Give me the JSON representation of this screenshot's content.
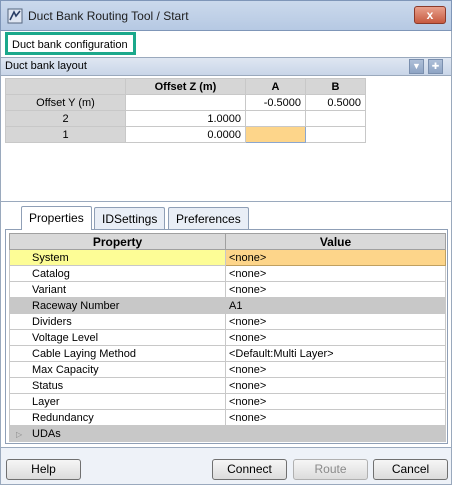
{
  "window": {
    "title": "Duct Bank Routing Tool / Start",
    "close_label": "x"
  },
  "config": {
    "label": "Duct bank configuration"
  },
  "layout": {
    "header_label": "Duct bank layout",
    "grid": {
      "corner": "",
      "offset_z_header": "Offset Z (m)",
      "col_a": "A",
      "col_b": "B",
      "rows": [
        {
          "label": "Offset Y (m)",
          "z": "",
          "a": "-0.5000",
          "b": "0.5000"
        },
        {
          "label": "2",
          "z": "1.0000",
          "a": "",
          "b": ""
        },
        {
          "label": "1",
          "z": "0.0000",
          "a": "",
          "b": ""
        }
      ]
    }
  },
  "tabs": [
    {
      "label": "Properties"
    },
    {
      "label": "IDSettings"
    },
    {
      "label": "Preferences"
    }
  ],
  "properties": {
    "header_property": "Property",
    "header_value": "Value",
    "rows": [
      {
        "name": "System",
        "value": "<none>"
      },
      {
        "name": "Catalog",
        "value": "<none>"
      },
      {
        "name": "Variant",
        "value": "<none>"
      },
      {
        "name": "Raceway Number",
        "value": "A1"
      },
      {
        "name": "Dividers",
        "value": "<none>"
      },
      {
        "name": "Voltage Level",
        "value": "<none>"
      },
      {
        "name": "Cable Laying Method",
        "value": "<Default:Multi Layer>"
      },
      {
        "name": "Max Capacity",
        "value": "<none>"
      },
      {
        "name": "Status",
        "value": "<none>"
      },
      {
        "name": "Layer",
        "value": "<none>"
      },
      {
        "name": "Redundancy",
        "value": "<none>"
      },
      {
        "name": "UDAs",
        "value": ""
      }
    ]
  },
  "buttons": {
    "help": "Help",
    "connect": "Connect",
    "route": "Route",
    "cancel": "Cancel"
  }
}
